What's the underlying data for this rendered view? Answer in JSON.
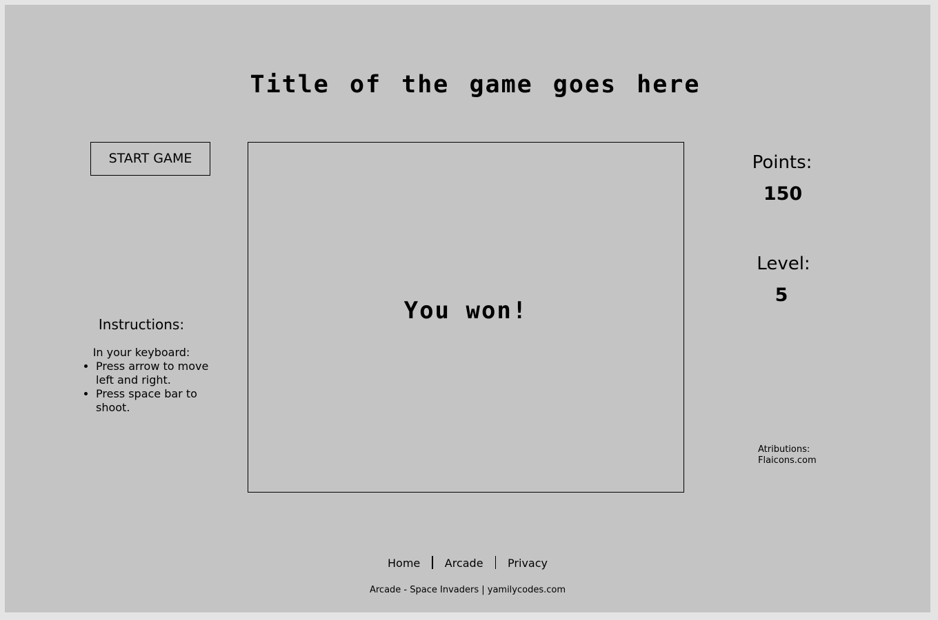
{
  "header": {
    "title": "Title of the game goes here"
  },
  "controls": {
    "start_label": "START GAME"
  },
  "game": {
    "message": "You won!"
  },
  "instructions": {
    "heading": "Instructions:",
    "subheading": "In your keyboard:",
    "items": [
      "Press arrow to move left and right.",
      "Press space bar to shoot."
    ]
  },
  "stats": {
    "points_label": "Points:",
    "points_value": "150",
    "level_label": "Level:",
    "level_value": "5"
  },
  "attributions": {
    "label": "Atributions:",
    "source": "Flaicons.com"
  },
  "footer": {
    "nav": [
      "Home",
      "Arcade",
      "Privacy"
    ],
    "credit": "Arcade - Space Invaders | yamilycodes.com"
  },
  "colors": {
    "page_background": "#e4e4e4",
    "panel_background": "#c4c4c4",
    "text": "#000000"
  }
}
